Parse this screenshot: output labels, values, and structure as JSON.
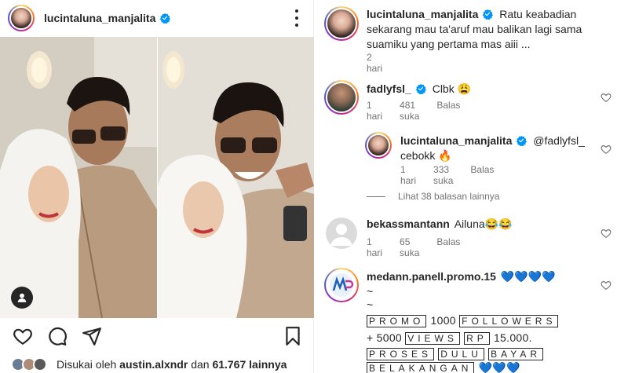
{
  "post": {
    "username": "lucintaluna_manjalita",
    "likes_prefix": "Disukai oleh",
    "likes_user": "austin.alxndr",
    "likes_connector": "dan",
    "likes_count": "61.767 lainnya"
  },
  "comments": [
    {
      "username": "lucintaluna_manjalita",
      "text": "Ratu keabadian sekarang mau ta'aruf mau balikan lagi sama suamiku yang pertama mas aiii ...",
      "time": "2 hari"
    },
    {
      "username": "fadlyfsl_",
      "text": "Clbk 😩",
      "time": "1 hari",
      "likes": "481 suka",
      "reply": "Balas"
    },
    {
      "username": "lucintaluna_manjalita",
      "text": "@fadlyfsl_ cebokk 🔥",
      "time": "1 hari",
      "likes": "333 suka",
      "reply": "Balas"
    },
    {
      "username": "bekassmantann",
      "text": "Ailuna😂😂",
      "time": "1 hari",
      "likes": "65 suka",
      "reply": "Balas"
    },
    {
      "username": "medann.panell.promo.15",
      "text": "💙💙💙💙",
      "promo_lines": [
        "~",
        "~"
      ],
      "promo_boxed_1": "PROMO",
      "promo_num_1": "1000",
      "promo_boxed_2": "FOLLOWERS",
      "promo_plus": "+ 5000",
      "promo_boxed_3": "VIEWS",
      "promo_boxed_4": "RP",
      "promo_price": "15.000.",
      "promo_boxed_5": "PROSES",
      "promo_boxed_6": "DULU",
      "promo_boxed_7": "BAYAR",
      "promo_boxed_8": "BELAKANGAN",
      "promo_hearts": "💙💙💙"
    }
  ],
  "view_replies": "Lihat 38 balasan lainnya",
  "colors": {
    "verified": "#0095f6",
    "text": "#262626",
    "muted": "#737373"
  },
  "icons": [
    "more-icon",
    "heart-icon",
    "comment-icon",
    "share-icon",
    "save-icon",
    "user-tag-icon",
    "verified-icon"
  ]
}
